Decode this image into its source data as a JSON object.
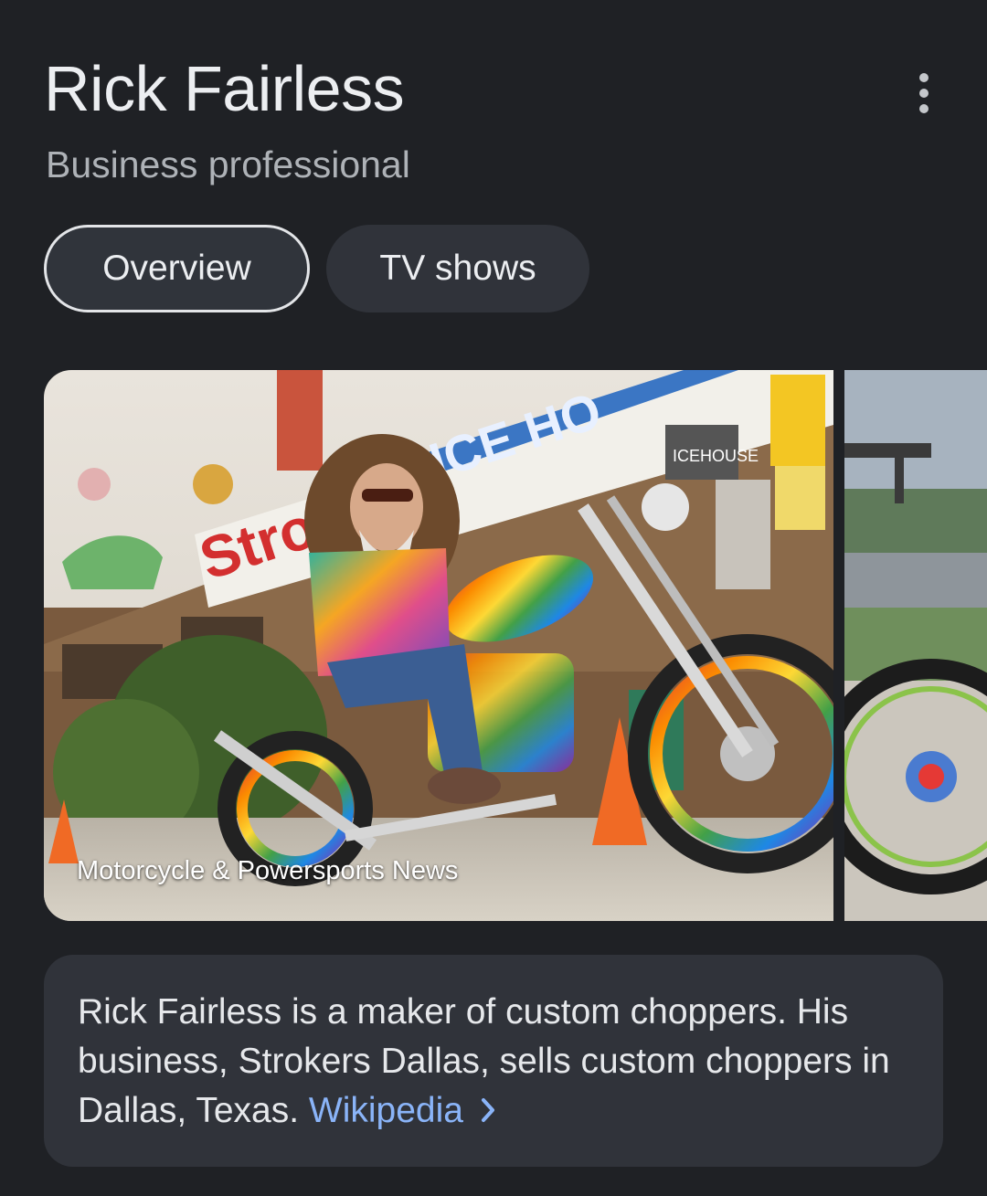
{
  "header": {
    "title": "Rick Fairless",
    "subtitle": "Business professional",
    "menu_icon": "more-vert-icon"
  },
  "tabs": [
    {
      "label": "Overview",
      "selected": true
    },
    {
      "label": "TV shows",
      "selected": false
    }
  ],
  "images": {
    "main_caption": "Motorcycle & Powersports News"
  },
  "description": {
    "text": "Rick Fairless is a maker of custom choppers. His business, Strokers Dallas, sells custom choppers in Dallas, Texas.",
    "source_link": "Wikipedia",
    "link_icon": "chevron-right-icon"
  },
  "colors": {
    "background": "#1f2125",
    "card": "#30333a",
    "link": "#8ab4f8"
  }
}
